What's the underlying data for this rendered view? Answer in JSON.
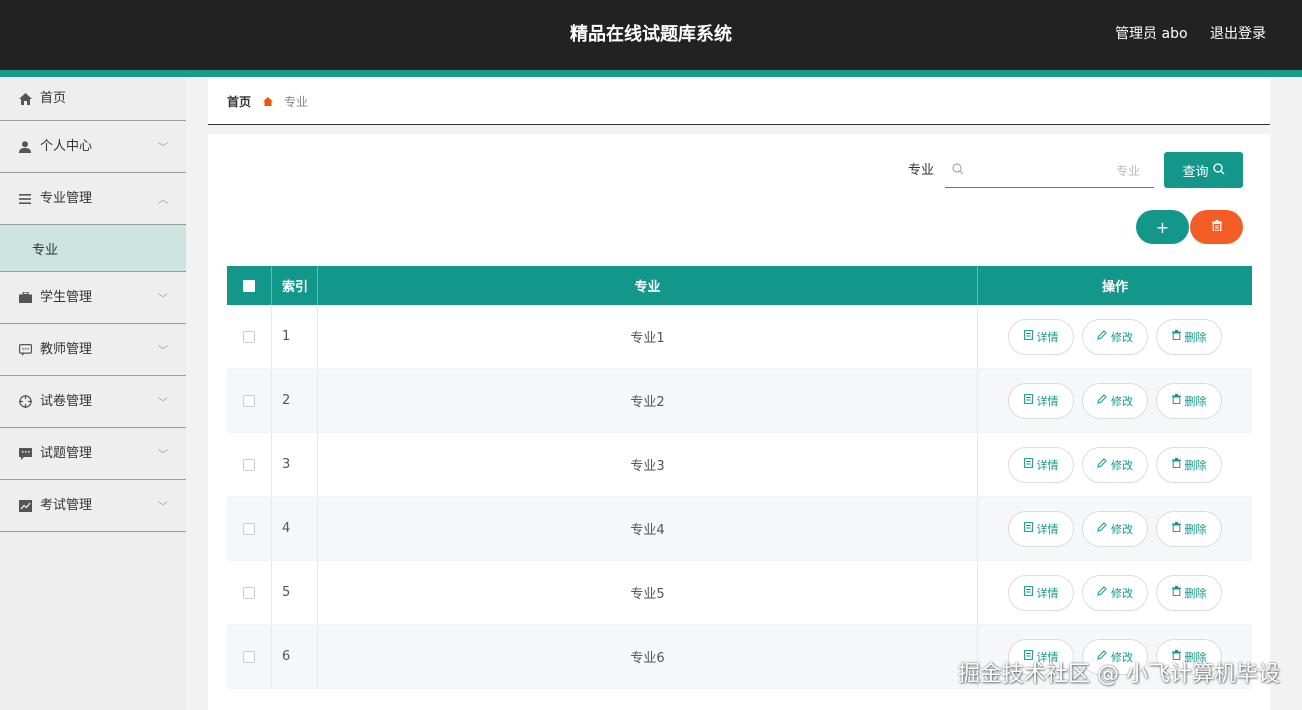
{
  "header": {
    "title": "精品在线试题库系统",
    "user": "管理员 abo",
    "logout": "退出登录"
  },
  "sidebar": {
    "items": [
      {
        "label": "首页",
        "icon": "home-icon"
      },
      {
        "label": "个人中心",
        "icon": "user-icon"
      },
      {
        "label": "专业管理",
        "icon": "list-icon",
        "expanded": true
      },
      {
        "label": "学生管理",
        "icon": "briefcase-icon"
      },
      {
        "label": "教师管理",
        "icon": "chat-icon"
      },
      {
        "label": "试卷管理",
        "icon": "target-icon"
      },
      {
        "label": "试题管理",
        "icon": "message-icon"
      },
      {
        "label": "考试管理",
        "icon": "chart-icon"
      }
    ],
    "sub_item": "专业"
  },
  "breadcrumb": {
    "home": "首页",
    "current": "专业"
  },
  "search": {
    "label": "专业",
    "placeholder": "专业",
    "button": "查询"
  },
  "actions": {
    "add": "+",
    "delete_icon": "trash-icon"
  },
  "table": {
    "headers": [
      "索引",
      "专业",
      "操作"
    ],
    "op_labels": {
      "detail": "详情",
      "edit": "修改",
      "delete": "删除"
    },
    "rows": [
      {
        "index": "1",
        "name": "专业1"
      },
      {
        "index": "2",
        "name": "专业2"
      },
      {
        "index": "3",
        "name": "专业3"
      },
      {
        "index": "4",
        "name": "专业4"
      },
      {
        "index": "5",
        "name": "专业5"
      },
      {
        "index": "6",
        "name": "专业6"
      }
    ]
  },
  "watermark": "掘金技术社区 @ 小飞计算机毕设",
  "colors": {
    "header_bg": "#222222",
    "accent": "#13978a",
    "danger": "#f25c25",
    "sidebar_bg": "#eeeeee",
    "sub_item_bg": "#cde5df"
  }
}
